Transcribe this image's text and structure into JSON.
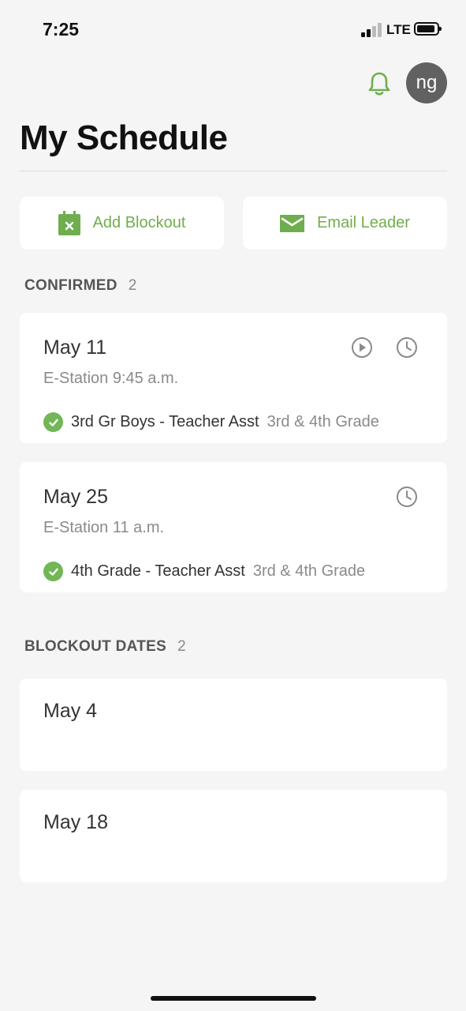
{
  "status_bar": {
    "time": "7:25",
    "network": "LTE"
  },
  "header": {
    "avatar_initials": "ng",
    "title": "My Schedule"
  },
  "actions": {
    "add_blockout": "Add Blockout",
    "email_leader": "Email Leader"
  },
  "confirmed": {
    "label": "CONFIRMED",
    "count": "2",
    "items": [
      {
        "date": "May 11",
        "location_time": "E-Station 9:45 a.m.",
        "role": "3rd Gr Boys - Teacher Asst",
        "team": "3rd & 4th Grade"
      },
      {
        "date": "May 25",
        "location_time": "E-Station 11 a.m.",
        "role": "4th Grade - Teacher Asst",
        "team": "3rd & 4th Grade"
      }
    ]
  },
  "blockouts": {
    "label": "BLOCKOUT DATES",
    "count": "2",
    "items": [
      {
        "date": "May 4"
      },
      {
        "date": "May 18"
      }
    ]
  },
  "colors": {
    "accent_green": "#6fae4e",
    "check_green": "#72b655",
    "background": "#f5f5f5"
  }
}
